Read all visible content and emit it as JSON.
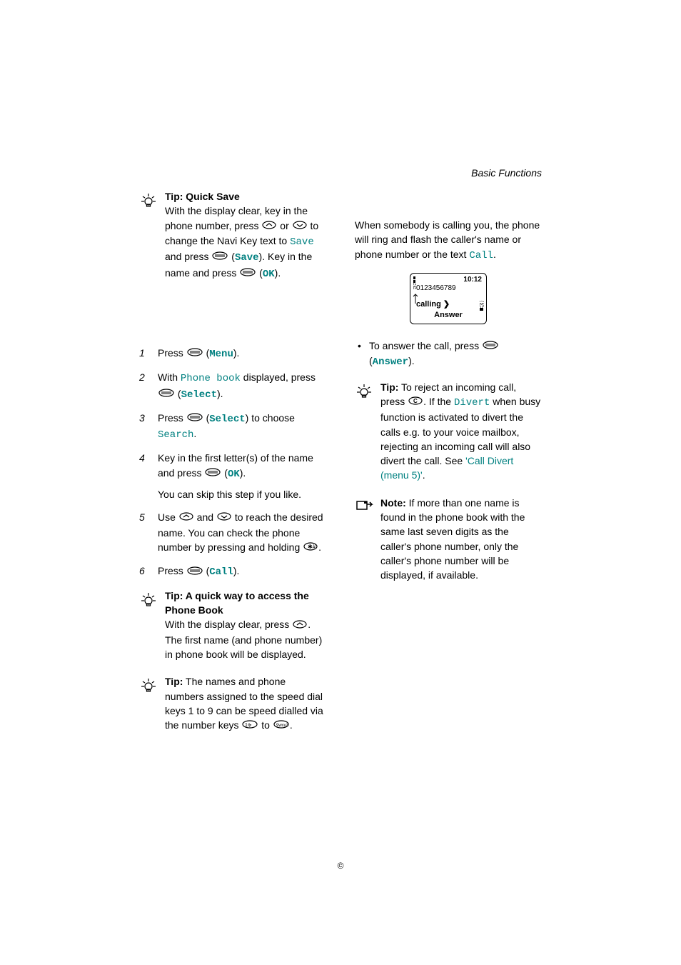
{
  "header": "Basic Functions",
  "tip1": {
    "title": "Tip: Quick Save",
    "line1a": "With the display clear, key in the phone number, press ",
    "line1b": " or ",
    "line1c": " to change the Navi Key text to ",
    "save_mono": "Save",
    "line1d": " and press ",
    "line1e": " (",
    "save_bold": "Save",
    "line1f": "). Key in the name and press ",
    "line1g": " (",
    "ok": "OK",
    "line1h": ")."
  },
  "steps": [
    {
      "n": "1",
      "a": "Press ",
      "b": " (",
      "label": "Menu",
      "c": ")."
    },
    {
      "n": "2",
      "a": "With ",
      "pb": "Phone book",
      "b": " displayed, press ",
      "c": " (",
      "label": "Select",
      "d": ")."
    },
    {
      "n": "3",
      "a": "Press ",
      "b": " (",
      "label": "Select",
      "c": ") to choose ",
      "search": "Search",
      "d": "."
    },
    {
      "n": "4",
      "a": "Key in the first letter(s) of the name and press ",
      "b": " (",
      "label": "OK",
      "c": ").",
      "sub": "You can skip this step if you like."
    },
    {
      "n": "5",
      "a": "Use ",
      "b": " and ",
      "c": " to reach the desired name. You can check the phone number by pressing and holding ",
      "d": "."
    },
    {
      "n": "6",
      "a": "Press ",
      "b": " (",
      "label": "Call",
      "c": ")."
    }
  ],
  "tip2": {
    "title": "Tip: A quick way to access the Phone Book",
    "a": "With the display clear, press ",
    "b": ". The first name (and phone number) in phone book will be displayed."
  },
  "tip3": {
    "label": "Tip:",
    "a": " The names and phone numbers assigned to the speed dial keys 1 to 9 can be speed dialled via the number keys ",
    "b": " to ",
    "c": "."
  },
  "right": {
    "intro_a": "When somebody is calling you, the phone will ring and flash the caller's name or phone number or the text ",
    "intro_call": "Call",
    "intro_b": ".",
    "screen": {
      "time": "10:12",
      "number": "0123456789",
      "calling": "calling ",
      "answer": "Answer"
    },
    "answer_a": "To answer the call, press ",
    "answer_b": " (",
    "answer_label": "Answer",
    "answer_c": ")."
  },
  "tip4": {
    "label": "Tip:",
    "a": " To reject an incoming call, press ",
    "b": ". If the ",
    "divert": "Divert",
    "c": " when busy function is activated to divert the calls e.g. to your voice mailbox, rejecting an incoming call will also divert the call. See ",
    "link": "'Call Divert (menu 5)'",
    "d": "."
  },
  "note": {
    "label": "Note:",
    "text": " If more than one name is found in the phone book with the same last seven digits as the caller's phone number, only the caller's phone number will be displayed, if available."
  },
  "footer": "©"
}
